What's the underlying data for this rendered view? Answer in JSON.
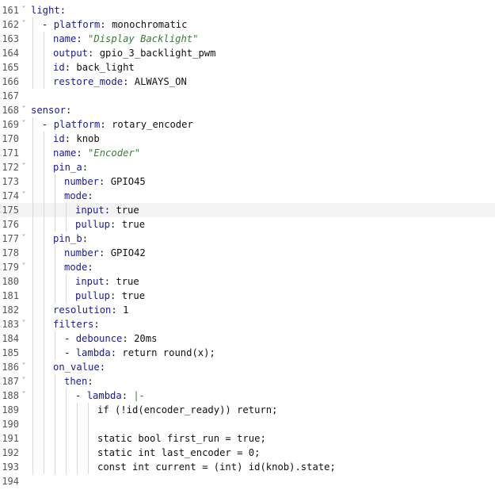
{
  "editor": {
    "lines": [
      {
        "n": "161",
        "indent": 0,
        "fold": true,
        "dash": false,
        "key": "light",
        "colon": ":",
        "val": ""
      },
      {
        "n": "162",
        "indent": 1,
        "fold": true,
        "dash": true,
        "key": "platform",
        "colon": ": ",
        "val": "monochromatic"
      },
      {
        "n": "163",
        "indent": 2,
        "fold": false,
        "dash": false,
        "key": "name",
        "colon": ": ",
        "val": "\"Display Backlight\"",
        "str": true
      },
      {
        "n": "164",
        "indent": 2,
        "fold": false,
        "dash": false,
        "key": "output",
        "colon": ": ",
        "val": "gpio_3_backlight_pwm"
      },
      {
        "n": "165",
        "indent": 2,
        "fold": false,
        "dash": false,
        "key": "id",
        "colon": ": ",
        "val": "back_light"
      },
      {
        "n": "166",
        "indent": 2,
        "fold": false,
        "dash": false,
        "key": "restore_mode",
        "colon": ": ",
        "val": "ALWAYS_ON"
      },
      {
        "n": "167",
        "indent": 0,
        "fold": false,
        "dash": false,
        "key": "",
        "colon": "",
        "val": ""
      },
      {
        "n": "168",
        "indent": 0,
        "fold": true,
        "dash": false,
        "key": "sensor",
        "colon": ":",
        "val": ""
      },
      {
        "n": "169",
        "indent": 1,
        "fold": true,
        "dash": true,
        "key": "platform",
        "colon": ": ",
        "val": "rotary_encoder"
      },
      {
        "n": "170",
        "indent": 2,
        "fold": false,
        "dash": false,
        "key": "id",
        "colon": ": ",
        "val": "knob"
      },
      {
        "n": "171",
        "indent": 2,
        "fold": false,
        "dash": false,
        "key": "name",
        "colon": ": ",
        "val": "\"Encoder\"",
        "str": true
      },
      {
        "n": "172",
        "indent": 2,
        "fold": true,
        "dash": false,
        "key": "pin_a",
        "colon": ":",
        "val": ""
      },
      {
        "n": "173",
        "indent": 3,
        "fold": false,
        "dash": false,
        "key": "number",
        "colon": ": ",
        "val": "GPIO45"
      },
      {
        "n": "174",
        "indent": 3,
        "fold": true,
        "dash": false,
        "key": "mode",
        "colon": ":",
        "val": ""
      },
      {
        "n": "175",
        "indent": 4,
        "fold": false,
        "dash": false,
        "key": "input",
        "colon": ": ",
        "val": "true",
        "current": true
      },
      {
        "n": "176",
        "indent": 4,
        "fold": false,
        "dash": false,
        "key": "pullup",
        "colon": ": ",
        "val": "true"
      },
      {
        "n": "177",
        "indent": 2,
        "fold": true,
        "dash": false,
        "key": "pin_b",
        "colon": ":",
        "val": ""
      },
      {
        "n": "178",
        "indent": 3,
        "fold": false,
        "dash": false,
        "key": "number",
        "colon": ": ",
        "val": "GPIO42"
      },
      {
        "n": "179",
        "indent": 3,
        "fold": true,
        "dash": false,
        "key": "mode",
        "colon": ":",
        "val": ""
      },
      {
        "n": "180",
        "indent": 4,
        "fold": false,
        "dash": false,
        "key": "input",
        "colon": ": ",
        "val": "true"
      },
      {
        "n": "181",
        "indent": 4,
        "fold": false,
        "dash": false,
        "key": "pullup",
        "colon": ": ",
        "val": "true"
      },
      {
        "n": "182",
        "indent": 2,
        "fold": false,
        "dash": false,
        "key": "resolution",
        "colon": ": ",
        "val": "1"
      },
      {
        "n": "183",
        "indent": 2,
        "fold": true,
        "dash": false,
        "key": "filters",
        "colon": ":",
        "val": ""
      },
      {
        "n": "184",
        "indent": 3,
        "fold": false,
        "dash": true,
        "key": "debounce",
        "colon": ": ",
        "val": "20ms"
      },
      {
        "n": "185",
        "indent": 3,
        "fold": false,
        "dash": true,
        "key": "lambda",
        "colon": ": ",
        "val": "return round(x);"
      },
      {
        "n": "186",
        "indent": 2,
        "fold": true,
        "dash": false,
        "key": "on_value",
        "colon": ":",
        "val": ""
      },
      {
        "n": "187",
        "indent": 3,
        "fold": true,
        "dash": false,
        "key": "then",
        "colon": ":",
        "val": ""
      },
      {
        "n": "188",
        "indent": 4,
        "fold": true,
        "dash": true,
        "key": "lambda",
        "colon": ": ",
        "val": "|-",
        "str": true
      },
      {
        "n": "189",
        "indent": 6,
        "fold": false,
        "dash": false,
        "key": "",
        "colon": "",
        "val": "if (!id(encoder_ready)) return;"
      },
      {
        "n": "190",
        "indent": 0,
        "fold": false,
        "dash": false,
        "key": "",
        "colon": "",
        "val": ""
      },
      {
        "n": "191",
        "indent": 6,
        "fold": false,
        "dash": false,
        "key": "",
        "colon": "",
        "val": "static bool first_run = true;"
      },
      {
        "n": "192",
        "indent": 6,
        "fold": false,
        "dash": false,
        "key": "",
        "colon": "",
        "val": "static int last_encoder = 0;"
      },
      {
        "n": "193",
        "indent": 6,
        "fold": false,
        "dash": false,
        "key": "",
        "colon": "",
        "val": "const int current = (int) id(knob).state;"
      },
      {
        "n": "194",
        "indent": 0,
        "fold": false,
        "dash": false,
        "key": "",
        "colon": "",
        "val": ""
      }
    ]
  },
  "colors": {
    "key": "#1b1b8c",
    "string": "#3d7a3d",
    "plain": "#111111",
    "gutter": "#555555",
    "current_line": "#f3f3f3",
    "indent_guide": "#d8d8d8"
  },
  "icons": {
    "fold": "chevron-down-icon"
  }
}
